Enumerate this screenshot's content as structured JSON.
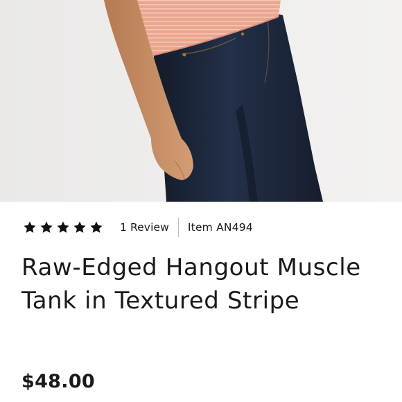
{
  "product": {
    "image_alt": "Model wearing a pink textured stripe tank with dark wash jeans",
    "rating": 5,
    "reviews_label": "1 Review",
    "item_number": "Item AN494",
    "title": "Raw-Edged Hangout Muscle Tank in Textured Stripe",
    "price": "$48.00"
  },
  "colors": {
    "background": "#ffffff",
    "text": "#1a1a1a",
    "divider": "#bdbdbd",
    "photo_backdrop": "#ecebea",
    "tank_pink": "#e9a58e",
    "denim": "#1d2738"
  },
  "icons": {
    "rating_star": "star-icon"
  }
}
